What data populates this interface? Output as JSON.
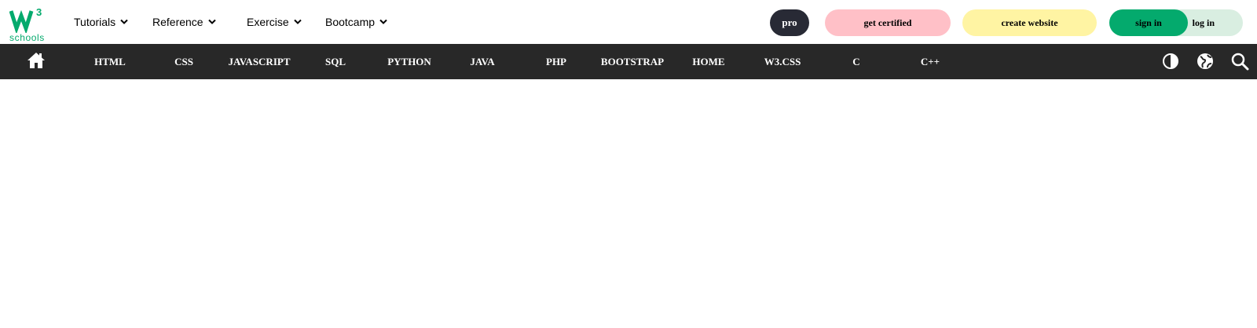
{
  "brand": {
    "logo_mark": "W3",
    "logo_superscript": "3",
    "logo_text": "schools",
    "accent_color": "#04AA6D"
  },
  "top_nav": [
    {
      "label": "Tutorials",
      "icon": "chevron-down-icon"
    },
    {
      "label": "Reference",
      "icon": "chevron-down-icon"
    },
    {
      "label": "Exercise",
      "icon": "chevron-down-icon"
    },
    {
      "label": "Bootcamp",
      "icon": "chevron-down-icon"
    }
  ],
  "actions": {
    "pro_label": "pro",
    "certified_label": "get certified",
    "website_label": "create website",
    "signin_label": "sign in",
    "login_label": "log in"
  },
  "colors": {
    "pro_bg": "#282a35",
    "certified_bg": "#ffc0c7",
    "website_bg": "#fff4a3",
    "signin_bg": "#04AA6D",
    "login_bg": "#d9eee1",
    "darkbar_bg": "#282828"
  },
  "subnav": {
    "home_icon": "home-icon",
    "topics": [
      "HTML",
      "CSS",
      "JAVASCRIPT",
      "SQL",
      "PYTHON",
      "JAVA",
      "PHP",
      "BOOTSTRAP",
      "HOME",
      "W3.CSS",
      "C",
      "C++"
    ],
    "right_icons": [
      "contrast-icon",
      "globe-icon",
      "search-icon"
    ]
  }
}
